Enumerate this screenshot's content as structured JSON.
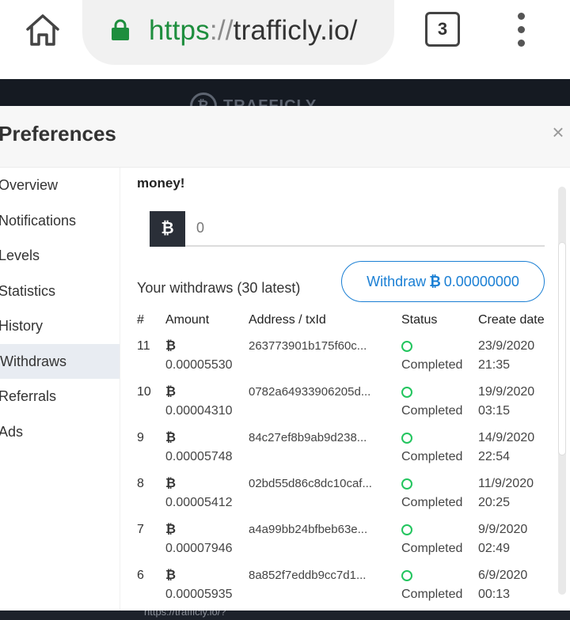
{
  "browser": {
    "url_scheme": "https",
    "url_sep": "://",
    "url_host": "trafficly.io/",
    "tab_count": "3",
    "icons": [
      "home-icon",
      "lock-icon",
      "menu-dots-icon"
    ]
  },
  "site": {
    "logo_text": "TRAFFICLY",
    "logo_symbol": "₿",
    "footer_text": "https://trafficly.io/?"
  },
  "modal": {
    "title": "Preferences",
    "close_label": "×"
  },
  "sidebar": {
    "items": [
      {
        "label": "Overview"
      },
      {
        "label": "Notifications"
      },
      {
        "label": "Levels"
      },
      {
        "label": "Statistics"
      },
      {
        "label": "History"
      },
      {
        "label": "Withdraws"
      },
      {
        "label": "Referrals"
      },
      {
        "label": "Ads"
      }
    ],
    "active": "Withdraws"
  },
  "withdraw": {
    "intro_text": "money!",
    "currency_symbol": "₿",
    "amount_value": "0",
    "heading": "Your withdraws (30 latest)",
    "button_prefix": "Withdraw",
    "button_symbol": "₿",
    "button_amount": "0.00000000"
  },
  "table": {
    "headers": {
      "num": "#",
      "amount": "Amount",
      "address": "Address / txId",
      "status": "Status",
      "date": "Create date"
    },
    "rows": [
      {
        "num": "11",
        "symbol": "₿",
        "amount": "0.00005530",
        "address": "263773901b175f60c...",
        "status": "Completed",
        "date": "23/9/2020",
        "time": "21:35"
      },
      {
        "num": "10",
        "symbol": "₿",
        "amount": "0.00004310",
        "address": "0782a64933906205d...",
        "status": "Completed",
        "date": "19/9/2020",
        "time": "03:15"
      },
      {
        "num": "9",
        "symbol": "₿",
        "amount": "0.00005748",
        "address": "84c27ef8b9ab9d238...",
        "status": "Completed",
        "date": "14/9/2020",
        "time": "22:54"
      },
      {
        "num": "8",
        "symbol": "₿",
        "amount": "0.00005412",
        "address": "02bd55d86c8dc10caf...",
        "status": "Completed",
        "date": "11/9/2020",
        "time": "20:25"
      },
      {
        "num": "7",
        "symbol": "₿",
        "amount": "0.00007946",
        "address": "a4a99bb24bfbeb63e...",
        "status": "Completed",
        "date": "9/9/2020",
        "time": "02:49"
      },
      {
        "num": "6",
        "symbol": "₿",
        "amount": "0.00005935",
        "address": "8a852f7eddb9cc7d1...",
        "status": "Completed",
        "date": "6/9/2020",
        "time": "00:13"
      }
    ]
  },
  "colors": {
    "link_blue": "#1a7fd4",
    "status_green": "#22c55e",
    "https_green": "#1e8e3e",
    "dark_bg": "#151a22"
  }
}
